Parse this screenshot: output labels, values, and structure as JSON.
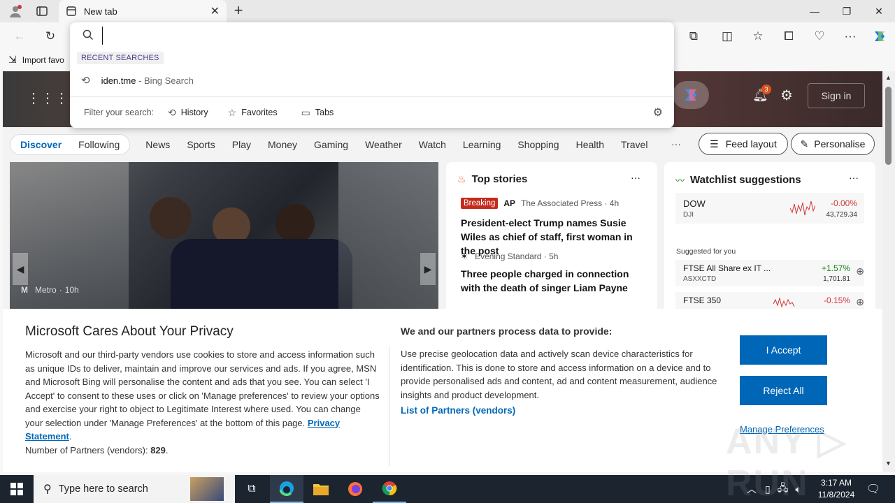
{
  "browser": {
    "tab_title": "New tab",
    "import_favorites": "Import favo"
  },
  "omnibox": {
    "value": "",
    "recent_label": "RECENT SEARCHES",
    "suggestion_query": "iden.tme",
    "suggestion_source": " - Bing Search",
    "filter_label": "Filter your search:",
    "filters": [
      "History",
      "Favorites",
      "Tabs"
    ]
  },
  "msn": {
    "notification_count": "3",
    "sign_in": "Sign in",
    "nav": [
      "Discover",
      "Following",
      "News",
      "Sports",
      "Play",
      "Money",
      "Gaming",
      "Weather",
      "Watch",
      "Learning",
      "Shopping",
      "Health",
      "Travel"
    ],
    "more": "···",
    "feed_layout": "Feed layout",
    "personalise": "Personalise",
    "hero": {
      "source": "Metro",
      "age": "10h"
    },
    "top_stories": {
      "title": "Top stories",
      "stories": [
        {
          "badge": "Breaking",
          "source": "The Associated Press · 4h",
          "headline": "President-elect Trump names Susie Wiles as chief of staff, first woman in the post"
        },
        {
          "source": "Evening Standard · 5h",
          "headline": "Three people charged in connection with the death of singer Liam Payne"
        }
      ]
    },
    "watchlist": {
      "title": "Watchlist suggestions",
      "main": {
        "name": "DOW",
        "sub": "DJI",
        "change": "-0.00%",
        "value": "43,729.34"
      },
      "suggested_label": "Suggested for you",
      "items": [
        {
          "name": "FTSE All Share ex IT ...",
          "sub": "ASXXCTD",
          "change": "+1.57%",
          "value": "1,701.81"
        },
        {
          "name": "FTSE 350",
          "sub": "",
          "change": "-0.15%",
          "value": ""
        }
      ]
    }
  },
  "privacy": {
    "title": "Microsoft Cares About Your Privacy",
    "body": "Microsoft and our third-party vendors use cookies to store and access information such as unique IDs to deliver, maintain and improve our services and ads. If you agree, MSN and Microsoft Bing will personalise the content and ads that you see. You can select 'I Accept' to consent to these uses or click on 'Manage preferences' to review your options and exercise your right to object to Legitimate Interest where used.  You can change your selection under 'Manage Preferences' at the bottom of this page. ",
    "privacy_link": "Privacy Statement",
    "partners_text": "Number of Partners (vendors): ",
    "partners_count": "829",
    "right_title": "We and our partners process data to provide:",
    "right_body": "Use precise geolocation data and actively scan device characteristics for identification. This is done to store and access information on a device and to provide personalised ads and content, ad and content measurement, audience insights and product development.",
    "partners_link": "List of Partners (vendors)",
    "accept": "I Accept",
    "reject": "Reject All",
    "manage": "Manage Preferences"
  },
  "taskbar": {
    "search_placeholder": "Type here to search",
    "time": "3:17 AM",
    "date": "11/8/2024"
  },
  "colors": {
    "accent": "#0067b8",
    "breaking": "#c42b1c",
    "negative": "#d13438",
    "positive": "#107c10"
  }
}
